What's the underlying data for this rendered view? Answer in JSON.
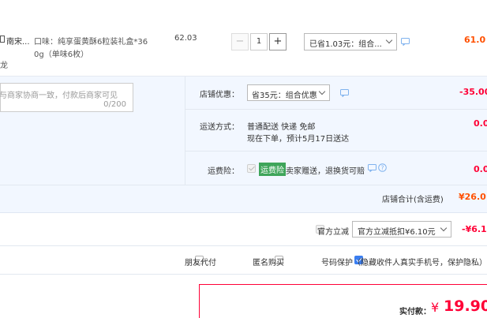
{
  "item": {
    "title": "南宋...",
    "sku_line1": "口味：纯享蛋黄酥6粒装礼盒*36",
    "sku_line2": "0g（单味6枚）",
    "sku_line3": "龙",
    "unit_price": "62.03",
    "qty_minus": "−",
    "qty_value": "1",
    "qty_plus": "+",
    "promo_select": "已省1.03元：组合...",
    "subtotal": "61.0"
  },
  "message": {
    "placeholder": "与商家协商一致，付款后商家可见",
    "count": "0/200"
  },
  "shop": {
    "discount_label": "店铺优惠：",
    "discount_select": "省35元：组合优惠",
    "discount_amount": "-35.00",
    "delivery_label": "运送方式：",
    "delivery_line1": "普通配送 快递 免邮",
    "delivery_line2": "现在下单，预计5月17日送达",
    "delivery_amount": "0.0",
    "insurance_label": "运费险：",
    "insurance_tag": "运费险",
    "insurance_text": "卖家赠送，退换货可赔",
    "insurance_amount": "0.0",
    "total_label": "店铺合计(含运费)",
    "total_value": "¥26.0"
  },
  "official": {
    "label": "官方立减",
    "select": "官方立减抵扣¥6.10元",
    "amount": "-¥6.1"
  },
  "options": {
    "friend_pay": "朋友代付",
    "anonymous": "匿名购买",
    "privacy": "号码保护（隐藏收件人真实手机号，保护隐私）"
  },
  "pay": {
    "label": "实付款：",
    "currency": "¥",
    "amount": "19.90"
  },
  "colors": {
    "red": "#ff0036",
    "orange": "#ff5000",
    "blue_check": "#3b7ef0",
    "panel_bg": "#f2f7ff"
  }
}
